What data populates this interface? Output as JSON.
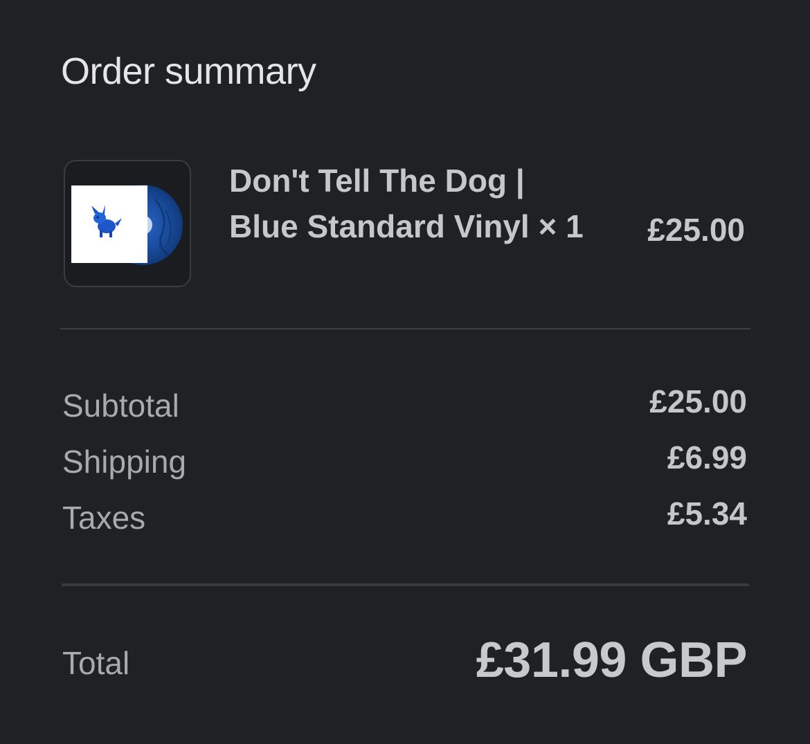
{
  "heading": "Order summary",
  "item": {
    "name": "Don't Tell The Dog | Blue Standard Vinyl × 1",
    "price": "£25.00",
    "thumbnail_icon": "vinyl-record-with-blue-dog-cover-icon",
    "vinyl_color": "#1a4ea0"
  },
  "summary": {
    "subtotal_label": "Subtotal",
    "subtotal_value": "£25.00",
    "shipping_label": "Shipping",
    "shipping_value": "£6.99",
    "taxes_label": "Taxes",
    "taxes_value": "£5.34"
  },
  "total": {
    "label": "Total",
    "value": "£31.99 GBP"
  },
  "colors": {
    "background": "#202125",
    "text_primary": "#c6c7cb",
    "text_secondary": "#a9aaae",
    "divider": "#3e3f44"
  }
}
